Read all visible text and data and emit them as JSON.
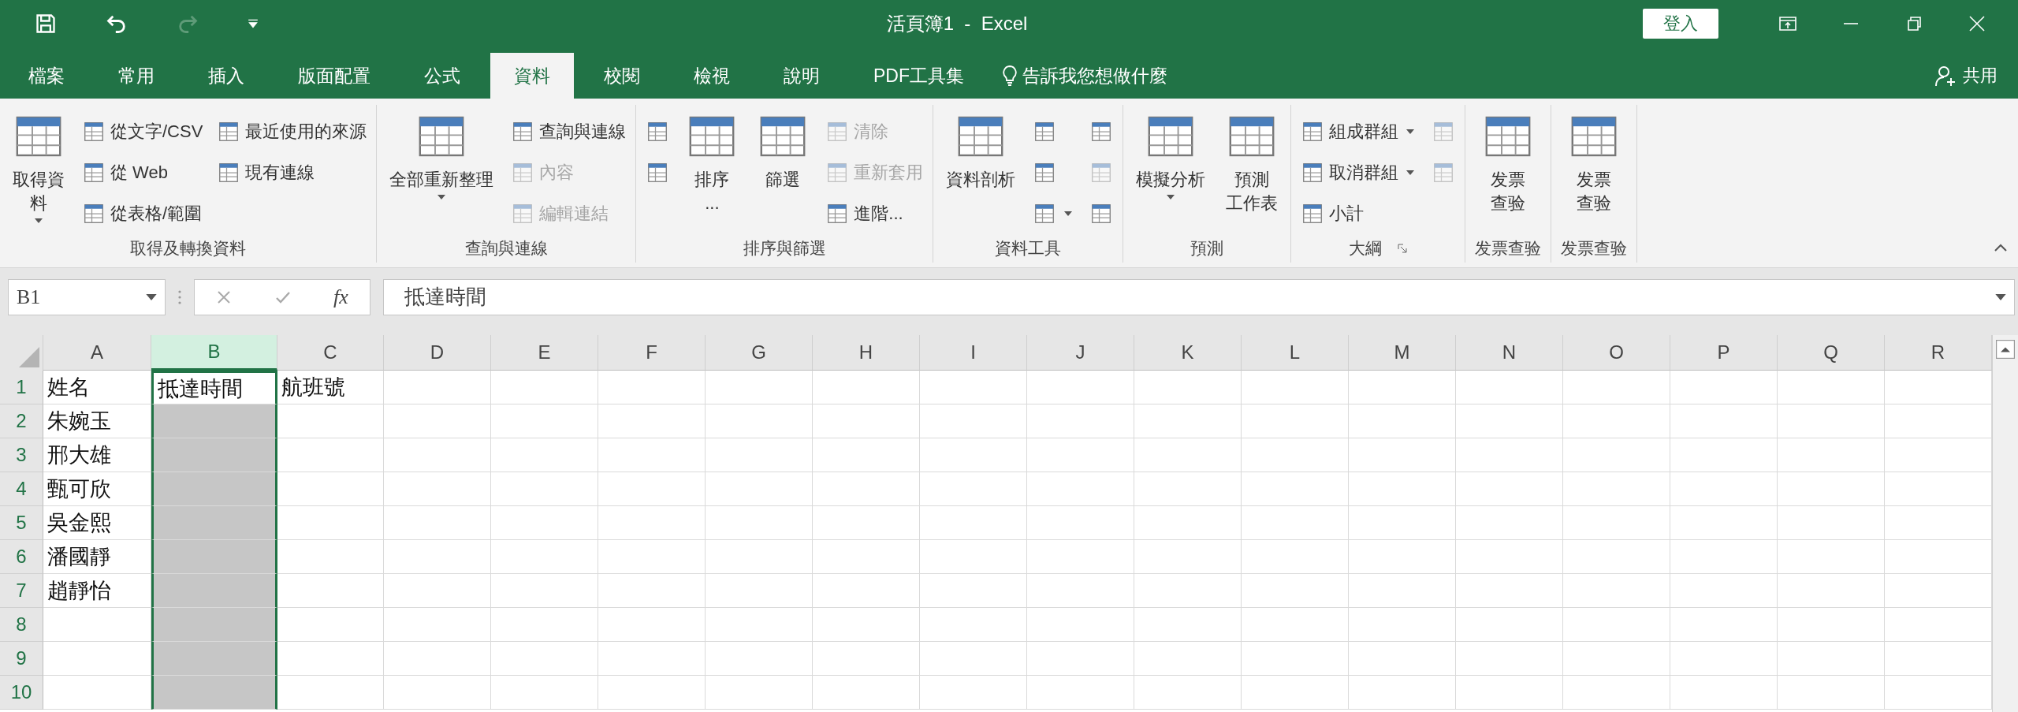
{
  "window": {
    "title": "活頁簿1  -  Excel",
    "sign_in": "登入"
  },
  "tabs": [
    {
      "label": "檔案",
      "selected": false
    },
    {
      "label": "常用",
      "selected": false
    },
    {
      "label": "插入",
      "selected": false
    },
    {
      "label": "版面配置",
      "selected": false
    },
    {
      "label": "公式",
      "selected": false
    },
    {
      "label": "資料",
      "selected": true
    },
    {
      "label": "校閱",
      "selected": false
    },
    {
      "label": "檢視",
      "selected": false
    },
    {
      "label": "說明",
      "selected": false
    },
    {
      "label": "PDF工具集",
      "selected": false
    }
  ],
  "tell_me": "告訴我您想做什麼",
  "share": "共用",
  "ribbon": {
    "groups": [
      {
        "label": "取得及轉換資料",
        "items": [
          {
            "kind": "large",
            "lines": [
              "取得資",
              "料"
            ],
            "dropdown": true,
            "disabled": false
          },
          {
            "kind": "small",
            "label": "從文字/CSV",
            "disabled": false
          },
          {
            "kind": "small",
            "label": "從 Web",
            "disabled": false
          },
          {
            "kind": "small",
            "label": "從表格/範圍",
            "disabled": false
          },
          {
            "kind": "small",
            "label": "最近使用的來源",
            "disabled": false
          },
          {
            "kind": "small",
            "label": "現有連線",
            "disabled": false
          }
        ]
      },
      {
        "label": "查詢與連線",
        "items": [
          {
            "kind": "large",
            "lines": [
              "全部重新整理"
            ],
            "dropdown": true,
            "disabled": false
          },
          {
            "kind": "small",
            "label": "查詢與連線",
            "disabled": false
          },
          {
            "kind": "small",
            "label": "內容",
            "disabled": true
          },
          {
            "kind": "small",
            "label": "編輯連結",
            "disabled": true
          }
        ]
      },
      {
        "label": "排序與篩選",
        "items": [
          {
            "kind": "icon",
            "disabled": false
          },
          {
            "kind": "icon",
            "disabled": false
          },
          {
            "kind": "large",
            "lines": [
              "排序",
              "..."
            ],
            "disabled": false
          },
          {
            "kind": "large",
            "lines": [
              "篩選"
            ],
            "disabled": false
          },
          {
            "kind": "small",
            "label": "清除",
            "disabled": true
          },
          {
            "kind": "small",
            "label": "重新套用",
            "disabled": true
          },
          {
            "kind": "small",
            "label": "進階...",
            "disabled": false
          }
        ]
      },
      {
        "label": "資料工具",
        "items": [
          {
            "kind": "large",
            "lines": [
              "資料剖析"
            ],
            "disabled": false
          },
          {
            "kind": "icon",
            "disabled": false
          },
          {
            "kind": "icon",
            "disabled": false
          },
          {
            "kind": "icon",
            "dropdown": true,
            "disabled": false
          },
          {
            "kind": "icon",
            "disabled": false
          },
          {
            "kind": "icon",
            "disabled": true
          },
          {
            "kind": "icon",
            "disabled": false
          }
        ]
      },
      {
        "label": "預測",
        "items": [
          {
            "kind": "large",
            "lines": [
              "模擬分析"
            ],
            "dropdown": true,
            "disabled": false
          },
          {
            "kind": "large",
            "lines": [
              "預測",
              "工作表"
            ],
            "disabled": false
          }
        ]
      },
      {
        "label": "大綱",
        "launcher": true,
        "items": [
          {
            "kind": "small",
            "label": "組成群組",
            "dropdown": true,
            "disabled": false
          },
          {
            "kind": "small",
            "label": "取消群組",
            "dropdown": true,
            "disabled": false
          },
          {
            "kind": "small",
            "label": "小計",
            "disabled": false
          },
          {
            "kind": "icon",
            "disabled": true
          },
          {
            "kind": "icon",
            "disabled": true
          }
        ]
      },
      {
        "label": "发票查验",
        "items": [
          {
            "kind": "large",
            "lines": [
              "发票",
              "查验"
            ],
            "disabled": false
          }
        ]
      },
      {
        "label": "发票查验",
        "items": [
          {
            "kind": "large",
            "lines": [
              "发票",
              "查验"
            ],
            "disabled": false
          }
        ]
      }
    ]
  },
  "formula_bar": {
    "name_box": "B1",
    "fx": "fx",
    "value": "抵達時間"
  },
  "sheet": {
    "columns": [
      {
        "label": "A",
        "selected": false
      },
      {
        "label": "B",
        "selected": true
      },
      {
        "label": "C",
        "selected": false
      },
      {
        "label": "D",
        "selected": false
      },
      {
        "label": "E",
        "selected": false
      },
      {
        "label": "F",
        "selected": false
      },
      {
        "label": "G",
        "selected": false
      },
      {
        "label": "H",
        "selected": false
      },
      {
        "label": "I",
        "selected": false
      },
      {
        "label": "J",
        "selected": false
      },
      {
        "label": "K",
        "selected": false
      },
      {
        "label": "L",
        "selected": false
      },
      {
        "label": "M",
        "selected": false
      },
      {
        "label": "N",
        "selected": false
      },
      {
        "label": "O",
        "selected": false
      },
      {
        "label": "P",
        "selected": false
      },
      {
        "label": "Q",
        "selected": false
      },
      {
        "label": "R",
        "selected": false
      }
    ],
    "rows": [
      {
        "label": "1",
        "selected": true,
        "active": true,
        "cells": [
          "姓名",
          "抵達時間",
          "航班號"
        ]
      },
      {
        "label": "2",
        "selected": true,
        "active": false,
        "cells": [
          "朱婉玉"
        ]
      },
      {
        "label": "3",
        "selected": true,
        "active": false,
        "cells": [
          "邢大雄"
        ]
      },
      {
        "label": "4",
        "selected": true,
        "active": false,
        "cells": [
          "甄可欣"
        ]
      },
      {
        "label": "5",
        "selected": true,
        "active": false,
        "cells": [
          "吳金熙"
        ]
      },
      {
        "label": "6",
        "selected": true,
        "active": false,
        "cells": [
          "潘國靜"
        ]
      },
      {
        "label": "7",
        "selected": true,
        "active": false,
        "cells": [
          "趙靜怡"
        ]
      },
      {
        "label": "8",
        "selected": true,
        "active": false,
        "cells": []
      },
      {
        "label": "9",
        "selected": true,
        "active": false,
        "cells": []
      },
      {
        "label": "10",
        "selected": true,
        "active": false,
        "cells": []
      }
    ]
  }
}
